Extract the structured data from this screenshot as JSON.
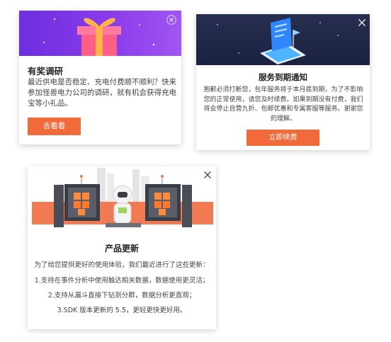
{
  "survey_card": {
    "title": "有奖调研",
    "body": "最近供电是否稳定、充电付费顺不顺利？快来参加怪兽电力公司的调研，就有机会获得充电宝等小礼品。",
    "button_label": "去看看",
    "icons": [
      "gift-icon",
      "close-icon"
    ],
    "colors": {
      "banner": "#7b35e6",
      "button": "#f06a3a"
    }
  },
  "service_card": {
    "title": "服务到期通知",
    "body": "抱歉必须打断您，包年服务将于本月底到期，为了不影响您的正常使用，请您及时续费。如果到期没有付费，我们将会停止自营九折、包邮优惠和专属客服等服务。谢谢您的理解。",
    "button_label": "立即续费",
    "icons": [
      "phone-notification-icon",
      "close-icon"
    ],
    "colors": {
      "banner": "#232944",
      "button": "#f06a3a"
    }
  },
  "update_card": {
    "title": "产品更新",
    "intro": "为了给您提供更好的使用体验，我们最近进行了这些更新：",
    "items": [
      "1.支持在事件分析中使用触达相关数据，数据使用更灵活；",
      "2.支持从漏斗直接下钻到分群，数据分析更直观；",
      "3.SDK 版本更新的 5.5，更轻更快更好用。"
    ],
    "icons": [
      "astronaut-robot-icon",
      "close-icon"
    ],
    "colors": {
      "stripe": "#f27a52"
    }
  }
}
